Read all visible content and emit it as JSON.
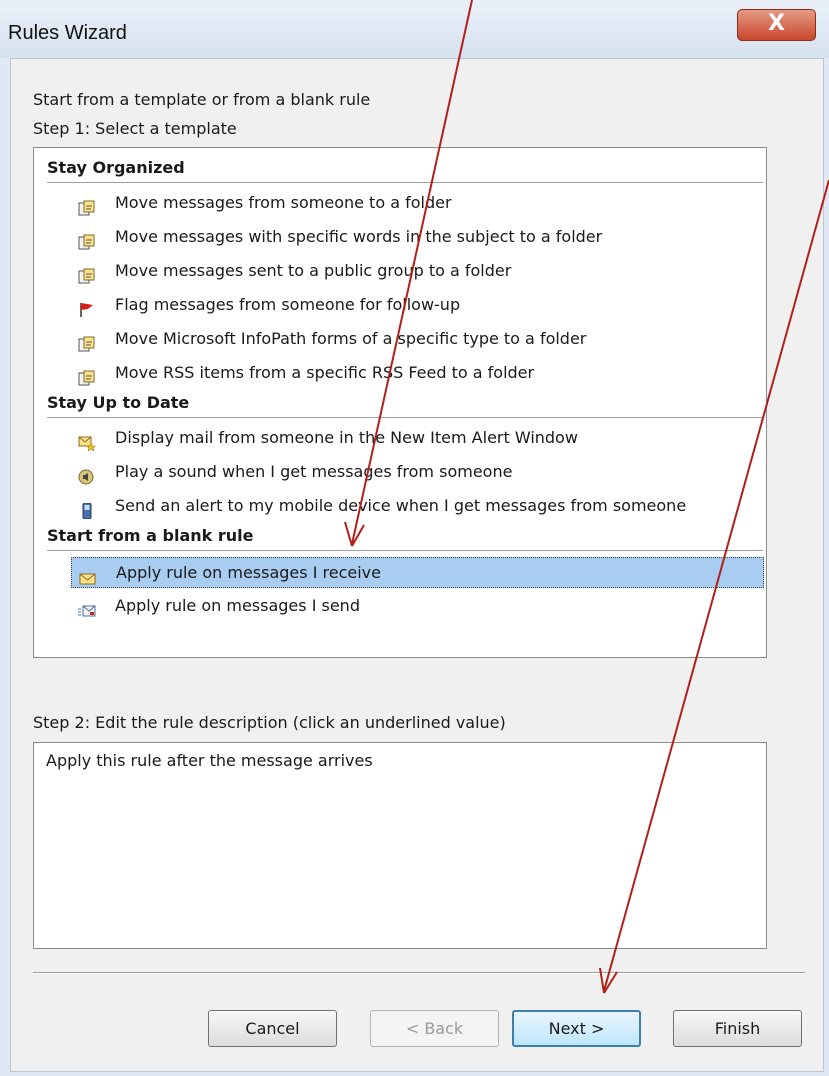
{
  "window": {
    "title": "Rules Wizard",
    "close_label": "X"
  },
  "intro": "Start from a template or from a blank rule",
  "step1": {
    "label": "Step 1: Select a template",
    "groups": [
      {
        "title": "Stay Organized",
        "items": [
          {
            "label": "Move messages from someone to a folder",
            "icon": "move-to-folder-icon"
          },
          {
            "label": "Move messages with specific words in the subject to a folder",
            "icon": "move-to-folder-icon"
          },
          {
            "label": "Move messages sent to a public group to a folder",
            "icon": "move-to-folder-icon"
          },
          {
            "label": "Flag messages from someone for follow-up",
            "icon": "flag-icon"
          },
          {
            "label": "Move Microsoft InfoPath forms of a specific type to a folder",
            "icon": "move-to-folder-icon"
          },
          {
            "label": "Move RSS items from a specific RSS Feed to a folder",
            "icon": "move-to-folder-icon"
          }
        ]
      },
      {
        "title": "Stay Up to Date",
        "items": [
          {
            "label": "Display mail from someone in the New Item Alert Window",
            "icon": "new-item-alert-icon"
          },
          {
            "label": "Play a sound when I get messages from someone",
            "icon": "speaker-icon"
          },
          {
            "label": "Send an alert to my mobile device when I get messages from someone",
            "icon": "mobile-phone-icon"
          }
        ]
      },
      {
        "title": "Start from a blank rule",
        "items": [
          {
            "label": "Apply rule on messages I receive",
            "icon": "envelope-icon",
            "selected": true
          },
          {
            "label": "Apply rule on messages I send",
            "icon": "send-mail-icon"
          }
        ]
      }
    ]
  },
  "step2": {
    "label": "Step 2: Edit the rule description (click an underlined value)",
    "description": "Apply this rule after the message arrives"
  },
  "buttons": {
    "cancel": "Cancel",
    "back": "< Back",
    "next": "Next >",
    "finish": "Finish"
  },
  "colors": {
    "selection": "#a9cdf0",
    "annotation_arrow": "#b0201a"
  }
}
